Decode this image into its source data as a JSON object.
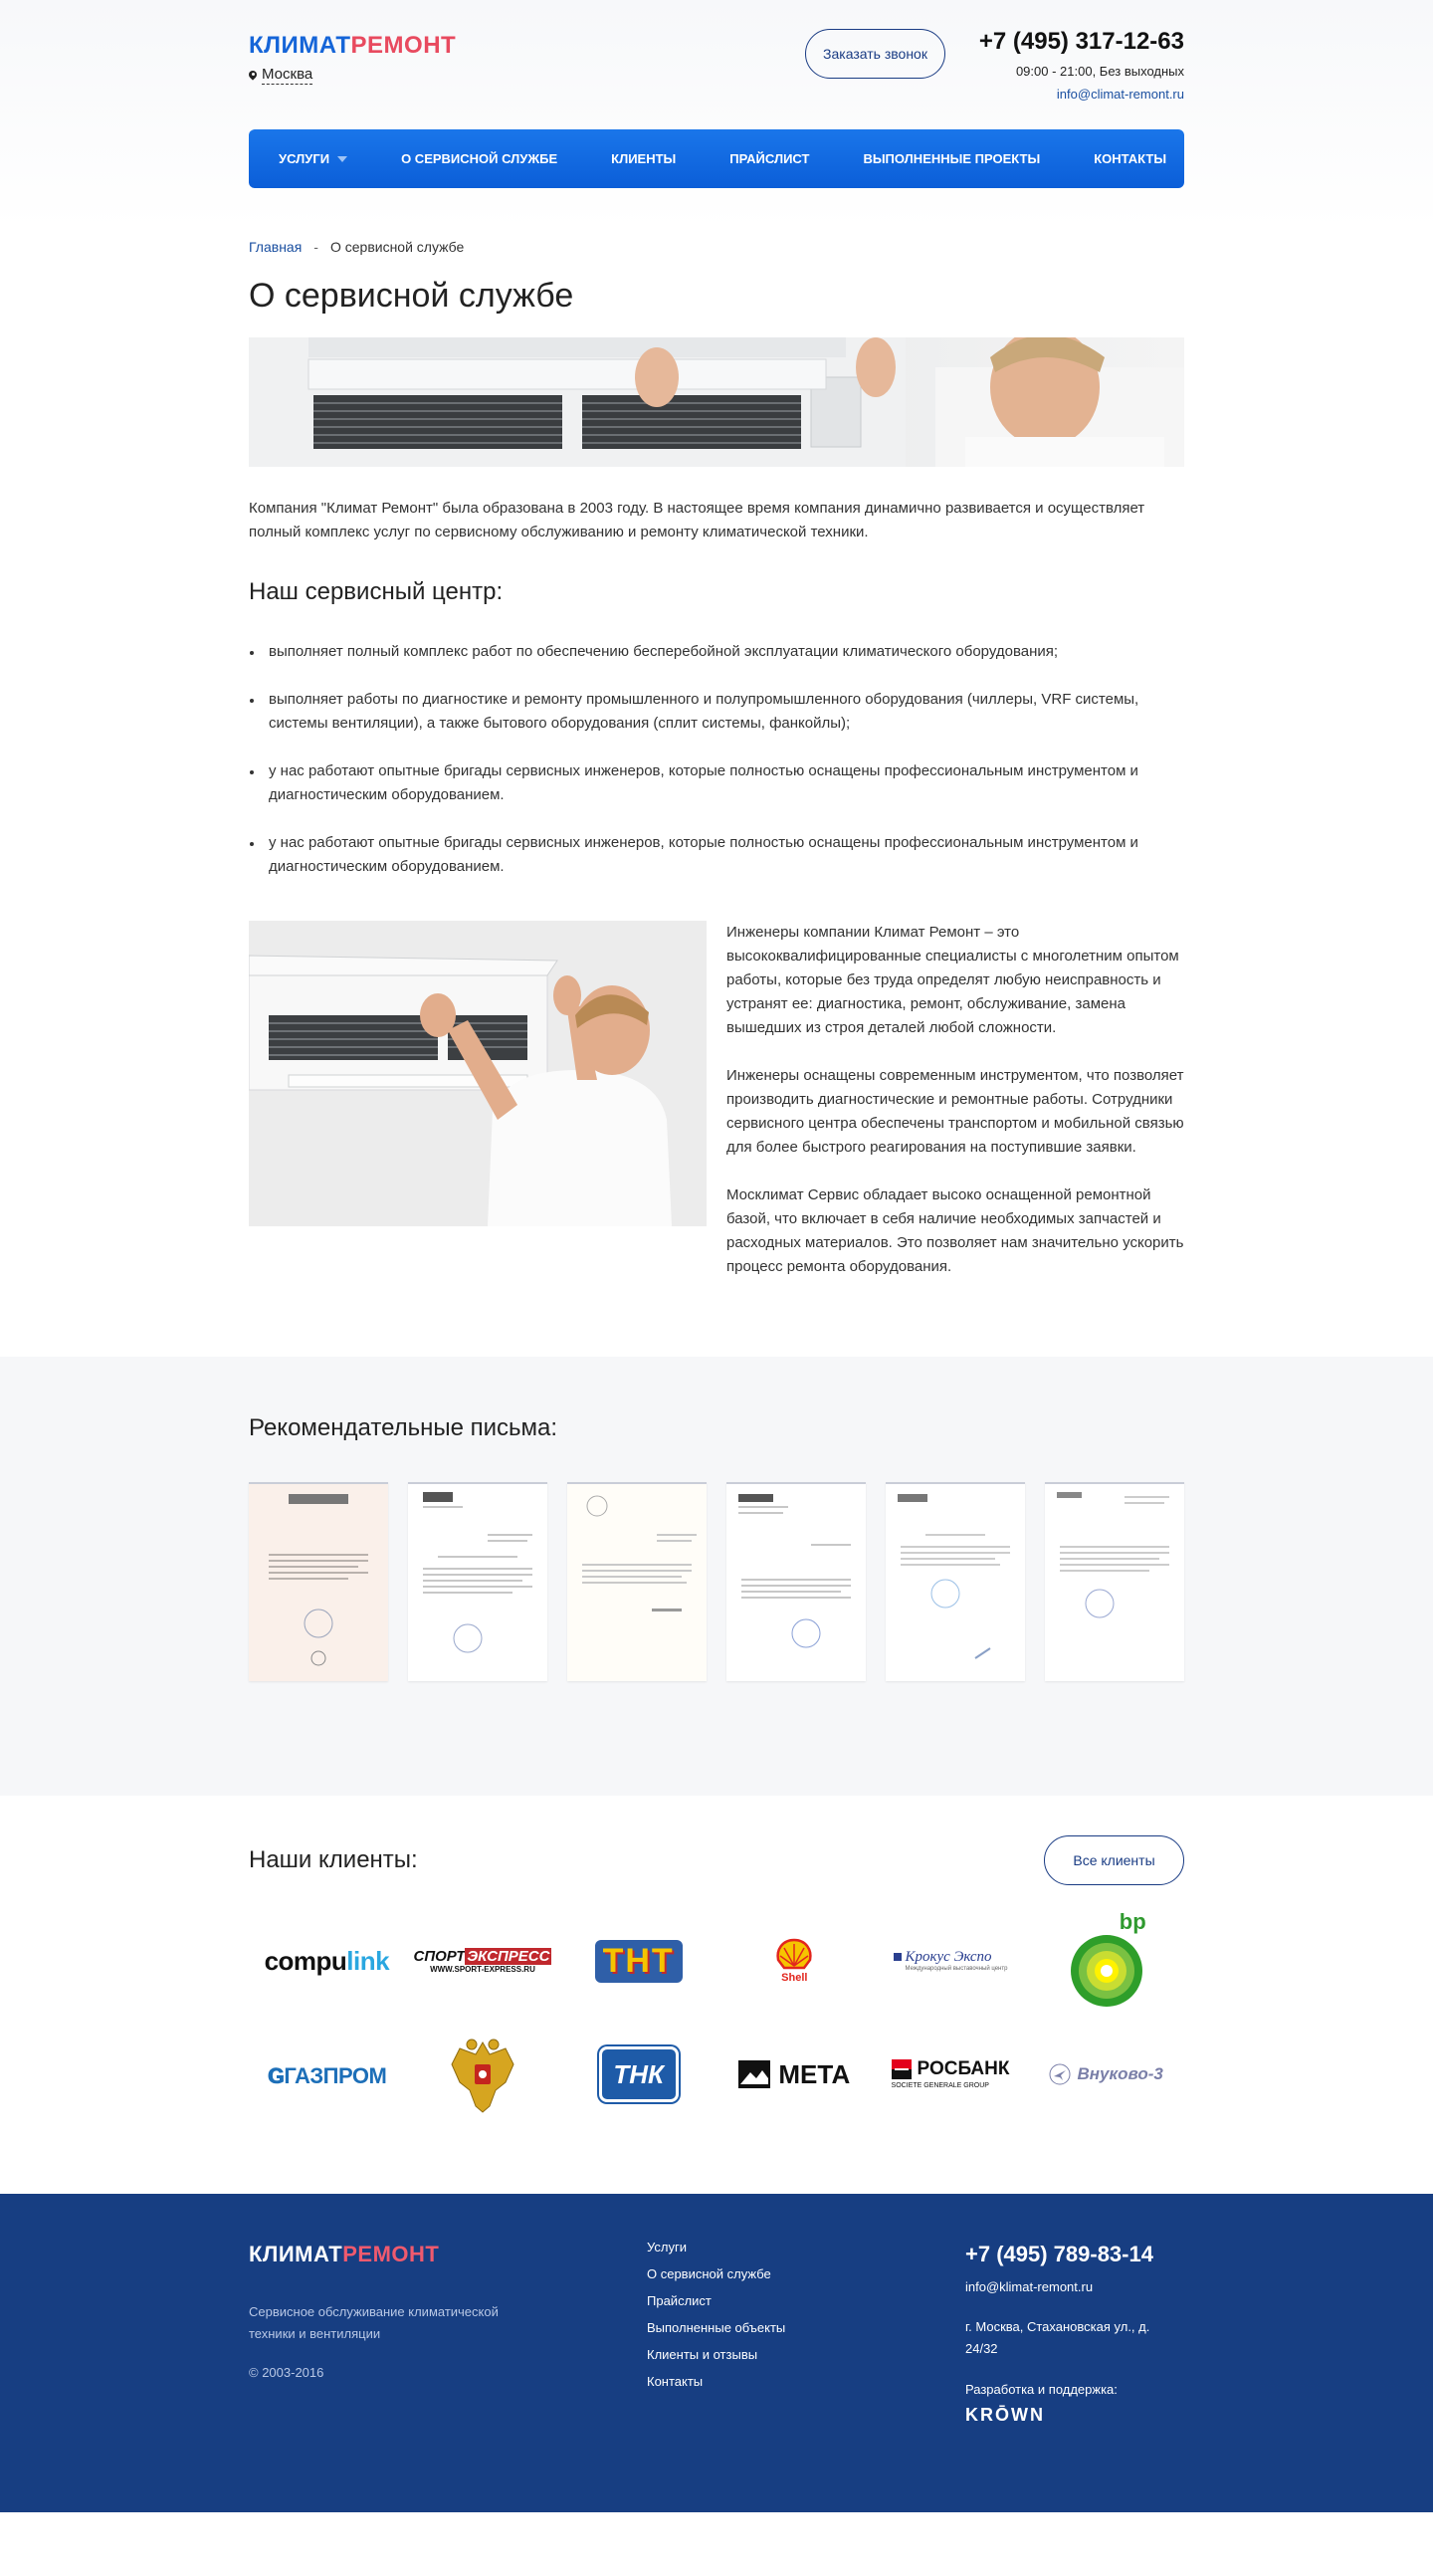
{
  "header": {
    "logo_part1": "КЛИМАТ",
    "logo_part2": "РЕМОНТ",
    "city": "Москва",
    "callback_label": "Заказать звонок",
    "phone": "+7 (495) 317-12-63",
    "hours": "09:00 - 21:00, Без выходных",
    "email": "info@climat-remont.ru"
  },
  "nav": {
    "items": [
      {
        "label": "Услуги",
        "has_dropdown": true
      },
      {
        "label": "О сервисной службе"
      },
      {
        "label": "Клиенты"
      },
      {
        "label": "Прайслист"
      },
      {
        "label": "Выполненные проекты"
      },
      {
        "label": "Контакты"
      }
    ]
  },
  "breadcrumb": {
    "home": "Главная",
    "separator": "-",
    "current": "О сервисной службе"
  },
  "page": {
    "title": "О сервисной службе",
    "intro": "Компания \"Климат Ремонт\" была образована в 2003 году. В настоящее время компания динамично развивается и осуществляет полный комплекс услуг по сервисному обслуживанию и ремонту климатической техники.",
    "service_center_title": "Наш сервисный центр:",
    "bullets": [
      "выполняет полный комплекс работ по обеспечению бесперебойной эксплуатации климатического оборудования;",
      "выполняет работы по диагностике и ремонту промышленного и полупромышленного оборудования (чиллеры, VRF системы, системы вентиляции), а также бытового оборудования (сплит системы, фанкойлы);",
      "у нас работают опытные бригады сервисных инженеров, которые полностью оснащены профессиональным инструментом и диагностическим оборудованием.",
      "у нас работают опытные бригады сервисных инженеров, которые полностью оснащены профессиональным инструментом и диагностическим оборудованием."
    ],
    "paragraphs": [
      "Инженеры компании Климат Ремонт – это высококвалифицированные специалисты с многолетним опытом работы, которые без труда определят любую неисправность и устранят ее: диагностика, ремонт, обслуживание, замена вышедших из строя деталей любой сложности.",
      "Инженеры оснащены современным инструментом, что позволяет производить диагностические и ремонтные работы. Сотрудники сервисного центра обеспечены транспортом и мобильной связью для более быстрого реагирования на поступившие заявки.",
      "Москлимат Сервис обладает высоко оснащенной ремонтной базой, что включает в себя наличие необходимых запчастей и расходных материалов. Это позволяет нам значительно ускорить процесс ремонта оборудования."
    ]
  },
  "letters": {
    "title": "Рекомендательные письма:",
    "items": [
      "letter-1",
      "letter-2",
      "letter-3",
      "letter-4",
      "letter-5",
      "letter-6"
    ]
  },
  "clients": {
    "title": "Наши клиенты:",
    "all_label": "Все клиенты",
    "logos": {
      "compulink_a": "compu",
      "compulink_b": "link",
      "sport_a": "СПОРТ",
      "sport_b": "ЭКСПРЕСС",
      "sport_url": "WWW.SPORT-EXPRESS.RU",
      "tnt": "ТНТ",
      "shell": "Shell",
      "crocus": "Крокус Экспо",
      "crocus_sub": "Международный выставочный центр",
      "bp": "bp",
      "gazprom": "ГАЗПРОМ",
      "tnk": "ТНК",
      "meta": "МЕТА",
      "rosbank": "РОСБАНК",
      "rosbank_sub": "SOCIETE GENERALE GROUP",
      "vnukovo": "Внуково-3"
    }
  },
  "footer": {
    "logo_part1": "КЛИМАТ",
    "logo_part2": "РЕМОНТ",
    "description": "Сервисное обслуживание климатической техники и вентиляции",
    "copyright": "© 2003-2016",
    "menu": [
      "Услуги",
      "О сервисной службе",
      "Прайслист",
      "Выполненные объекты",
      "Клиенты и отзывы",
      "Контакты"
    ],
    "phone": "+7 (495) 789-83-14",
    "email": "info@klimat-remont.ru",
    "address": "г. Москва, Стахановская ул., д. 24/32",
    "dev_label": "Разработка и поддержка:",
    "dev_logo": "KRŌWN"
  },
  "colors": {
    "brand_blue": "#1565d8",
    "brand_red": "#e84a5f",
    "nav_blue": "#0b6be0",
    "footer_blue": "#173e82"
  }
}
